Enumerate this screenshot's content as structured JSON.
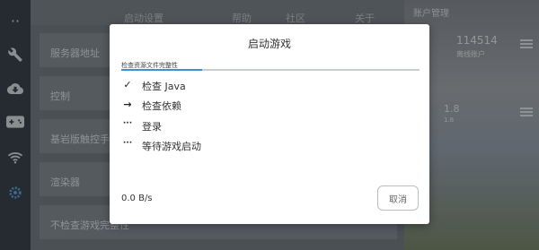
{
  "background": {
    "tabs": [
      "启动设置",
      "帮助",
      "社区",
      "关于"
    ],
    "rows": [
      "服务器地址",
      "控制",
      "基岩版触控手",
      "渲染器",
      "不检查游戏完整性"
    ],
    "right_panel": {
      "title": "账户管理",
      "account_name": "114514",
      "account_type": "离线账户",
      "version": "1.8",
      "version_sub": "1.8"
    },
    "sidebar_icons": [
      "more-icon",
      "wrench-icon",
      "cloud-download-icon",
      "gamepad-icon",
      "wifi-icon",
      "gear-icon"
    ]
  },
  "dialog": {
    "title": "启动游戏",
    "current_task": "检查资源文件完整性",
    "progress": 0.27,
    "steps": [
      {
        "icon": "check-icon",
        "glyph": "✓",
        "text": "检查 Java"
      },
      {
        "icon": "arrow-right-icon",
        "glyph": "→",
        "text": "检查依赖"
      },
      {
        "icon": "pending-icon",
        "glyph": "···",
        "text": "登录"
      },
      {
        "icon": "pending-icon",
        "glyph": "···",
        "text": "等待游戏启动"
      }
    ],
    "speed": "0.0 B/s",
    "cancel_label": "取消"
  },
  "colors": {
    "accent": "#3d8fd6",
    "dialog_bg": "#ffffff",
    "scrim": "rgba(0,0,0,0.38)"
  }
}
